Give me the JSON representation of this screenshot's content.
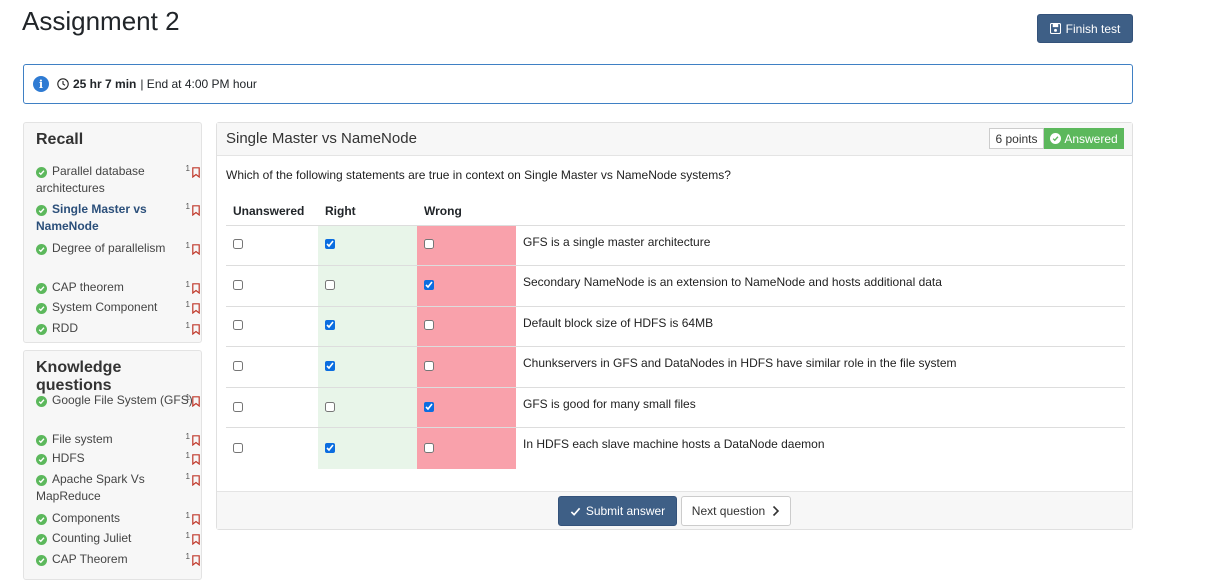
{
  "header": {
    "title": "Assignment 2",
    "finish_label": "Finish test"
  },
  "timer": {
    "time": "25 hr 7 min",
    "end_text": "| End at 4:00 PM hour"
  },
  "sidebar": {
    "recall": {
      "title": "Recall",
      "items": [
        {
          "label": "Parallel database architectures",
          "points": "1",
          "active": false
        },
        {
          "label": "Single Master vs NameNode",
          "points": "1",
          "active": true
        },
        {
          "label": "Degree of parallelism",
          "points": "1",
          "active": false
        },
        {
          "label": "CAP theorem",
          "points": "1",
          "active": false
        },
        {
          "label": "System Component",
          "points": "1",
          "active": false
        },
        {
          "label": "RDD",
          "points": "1",
          "active": false
        }
      ]
    },
    "knowledge": {
      "title": "Knowledge questions",
      "items": [
        {
          "label": "Google File System (GFS)",
          "points": "1"
        },
        {
          "label": "File system",
          "points": "1"
        },
        {
          "label": "HDFS",
          "points": "1"
        },
        {
          "label": "Apache Spark Vs MapReduce",
          "points": "1"
        },
        {
          "label": "Components",
          "points": "1"
        },
        {
          "label": "Counting Juliet",
          "points": "1"
        },
        {
          "label": "CAP Theorem",
          "points": "1"
        }
      ]
    }
  },
  "question": {
    "title": "Single Master vs NameNode",
    "points": "6 points",
    "status": "Answered",
    "prompt": "Which of the following statements are true in context on Single Master vs NameNode systems?",
    "columns": [
      "Unanswered",
      "Right",
      "Wrong"
    ],
    "rows": [
      {
        "statement": "GFS is a single master architecture",
        "selected": "right"
      },
      {
        "statement": "Secondary NameNode is an extension to NameNode and hosts additional data",
        "selected": "wrong"
      },
      {
        "statement": "Default block size of HDFS is 64MB",
        "selected": "right"
      },
      {
        "statement": "Chunkservers in GFS and DataNodes in HDFS have similar role in the file system",
        "selected": "right"
      },
      {
        "statement": "GFS is good for many small files",
        "selected": "wrong"
      },
      {
        "statement": "In HDFS each slave machine hosts a DataNode daemon",
        "selected": "right"
      }
    ]
  },
  "footer": {
    "submit_label": "Submit answer",
    "next_label": "Next question"
  },
  "colors": {
    "primary": "#3e5f86",
    "success": "#5cb85c",
    "right_bg": "#e8f5e9",
    "wrong_bg": "#f9a1ab",
    "bookmark": "#c0392b"
  },
  "icons": {
    "finish": "save-icon",
    "info": "info-icon",
    "clock": "clock-icon",
    "done": "check-circle-icon",
    "bookmark": "bookmark-icon",
    "submit": "check-icon",
    "next": "chevron-right-icon"
  }
}
